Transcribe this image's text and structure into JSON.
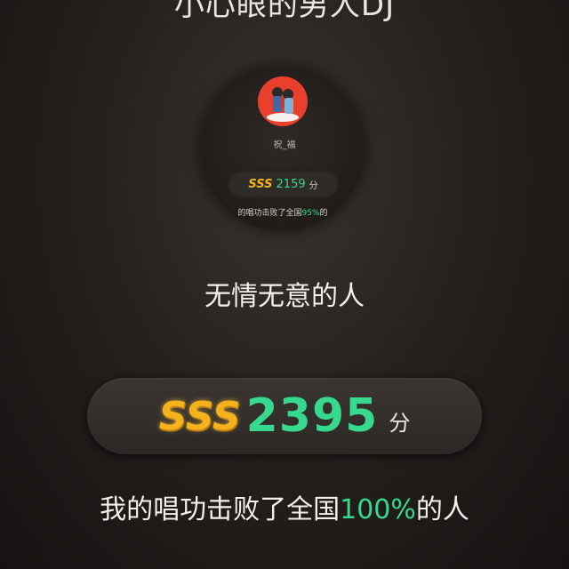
{
  "song": {
    "title": "小心眼的男人DJ"
  },
  "small_card": {
    "avatar_icon": "couple-avatar-icon",
    "name": "祝_福",
    "badge": "SSS",
    "score": "2159",
    "unit": "分",
    "beat_prefix": "的唱功击败了全国",
    "beat_percent": "95%",
    "beat_suffix": "的"
  },
  "lyric": "无情无意的人",
  "result": {
    "badge": "SSS",
    "score": "2395",
    "unit": "分",
    "beat_prefix": "我的唱功击败了全国",
    "beat_percent": "100%",
    "beat_suffix": "的人"
  },
  "colors": {
    "score_green": "#35d88d",
    "badge_gold": "#f6b21c",
    "avatar_red": "#e8402d"
  }
}
